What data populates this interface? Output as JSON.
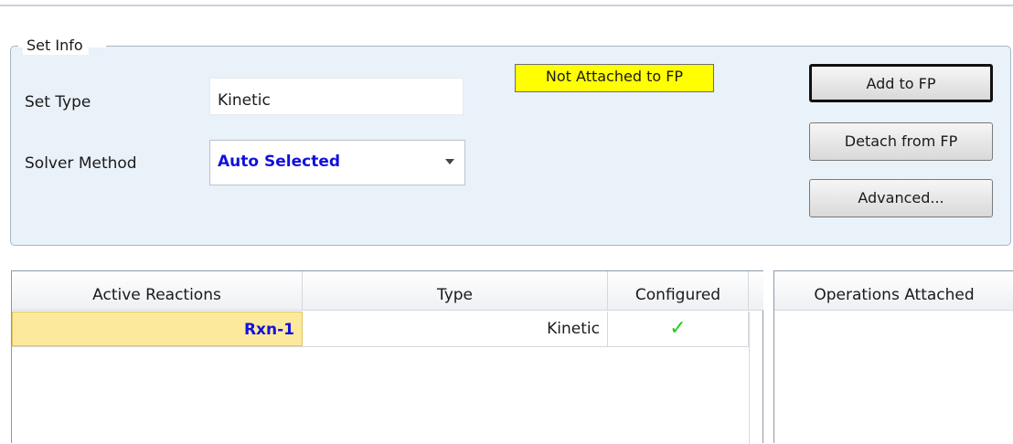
{
  "set_info": {
    "title": "Set Info",
    "set_type_label": "Set Type",
    "set_type_value": "Kinetic",
    "solver_method_label": "Solver Method",
    "solver_method_value": "Auto Selected",
    "status": "Not Attached to FP",
    "buttons": {
      "add": "Add to FP",
      "detach": "Detach from FP",
      "advanced": "Advanced..."
    }
  },
  "reactions_table": {
    "columns": [
      "Active Reactions",
      "Type",
      "Configured"
    ],
    "rows": [
      {
        "name": "Rxn-1",
        "type": "Kinetic",
        "configured": "✓"
      }
    ]
  },
  "operations": {
    "header": "Operations Attached"
  },
  "colors": {
    "status_bg": "#ffff00",
    "selected_cell": "#fde99c",
    "link_blue": "#1111dd",
    "check_green": "#22cc22",
    "group_bg": "#e9f1f9"
  }
}
